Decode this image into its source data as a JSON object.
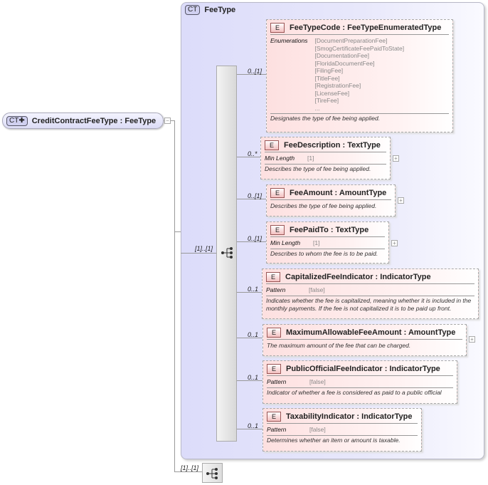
{
  "complex_type": {
    "badge": "CT",
    "label": "FeeType"
  },
  "root": {
    "badge": "CT",
    "name": "CreditContractFeeType",
    "type": "FeeType"
  },
  "sequence_multiplicity": "[1]..[1]",
  "bottom_multiplicity": "[1]..[1]",
  "elements": [
    {
      "badge": "E",
      "name": "FeeTypeCode",
      "type": "FeeTypeEnumeratedType",
      "multiplicity": "0..[1]",
      "facet_label": "Enumerations",
      "facet_values": [
        "[DocumentPreparationFee]",
        "[SmogCertificateFeePaidToState]",
        "[DocumentationFee]",
        "[FloridaDocumentFee]",
        "[FilingFee]",
        "[TitleFee]",
        "[RegistrationFee]",
        "[LicenseFee]",
        "[TireFee]",
        "..."
      ],
      "doc": "Designates the type of fee being applied.",
      "expandable": false
    },
    {
      "badge": "E",
      "name": "FeeDescription",
      "type": "TextType",
      "multiplicity": "0..*",
      "facet_label": "Min Length",
      "facet_values": [
        "[1]"
      ],
      "doc": "Describes the type of fee being applied.",
      "expandable": true
    },
    {
      "badge": "E",
      "name": "FeeAmount",
      "type": "AmountType",
      "multiplicity": "0..[1]",
      "facet_label": null,
      "facet_values": [],
      "doc": "Describes the type of fee being applied.",
      "expandable": true
    },
    {
      "badge": "E",
      "name": "FeePaidTo",
      "type": "TextType",
      "multiplicity": "0..[1]",
      "facet_label": "Min Length",
      "facet_values": [
        "[1]"
      ],
      "doc": "Describes to whom the fee is to be paid.",
      "expandable": true
    },
    {
      "badge": "E",
      "name": "CapitalizedFeeIndicator",
      "type": "IndicatorType",
      "multiplicity": "0..1",
      "facet_label": "Pattern",
      "facet_values": [
        "[false]"
      ],
      "doc": "Indicates whether the fee is capitalized, meaning whether it is included in the monthly payments. If the fee is not capitalized it is to be paid up front.",
      "expandable": false
    },
    {
      "badge": "E",
      "name": "MaximumAllowableFeeAmount",
      "type": "AmountType",
      "multiplicity": "0..1",
      "facet_label": null,
      "facet_values": [],
      "doc": "The maximum amount of the fee that can be charged.",
      "expandable": true
    },
    {
      "badge": "E",
      "name": "PublicOfficialFeeIndicator",
      "type": "IndicatorType",
      "multiplicity": "0..1",
      "facet_label": "Pattern",
      "facet_values": [
        "[false]"
      ],
      "doc": "Indicator of whether a fee is considered as paid to a public official",
      "expandable": false
    },
    {
      "badge": "E",
      "name": "TaxabilityIndicator",
      "type": "IndicatorType",
      "multiplicity": "0..1",
      "facet_label": "Pattern",
      "facet_values": [
        "[false]"
      ],
      "doc": "Determines whether an item or amount is taxable.",
      "expandable": false
    }
  ]
}
